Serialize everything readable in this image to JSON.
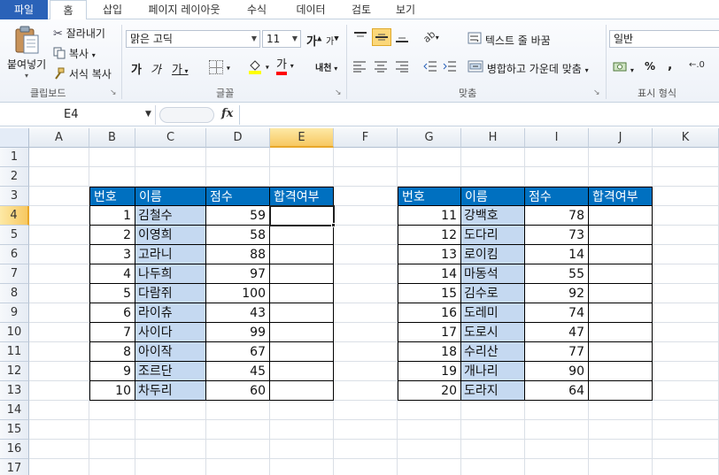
{
  "ribbon_tabs": {
    "file": "파일",
    "home": "홈",
    "insert": "삽입",
    "page_layout": "페이지 레이아웃",
    "formulas": "수식",
    "data": "데이터",
    "review": "검토",
    "view": "보기"
  },
  "clipboard": {
    "paste": "붙여넣기",
    "cut": "잘라내기",
    "copy": "복사",
    "format_painter": "서식 복사",
    "group_label": "클립보드"
  },
  "font": {
    "font_name": "맑은 고딕",
    "font_size": "11",
    "grow": "가",
    "shrink": "가",
    "bold": "가",
    "italic": "가",
    "underline": "가",
    "font_color_glyph": "가",
    "phonetic": "내천",
    "group_label": "글꼴",
    "fill_color": "#ffff00",
    "text_color": "#ff0000"
  },
  "alignment": {
    "wrap_text": "텍스트 줄 바꿈",
    "merge_center": "병합하고 가운데 맞춤",
    "group_label": "맞춤"
  },
  "number": {
    "format": "일반",
    "percent": "%",
    "comma": ",",
    "group_label": "표시 형식"
  },
  "formula_bar": {
    "name_box": "E4",
    "fx": "fx",
    "content": ""
  },
  "columns": [
    "A",
    "B",
    "C",
    "D",
    "E",
    "F",
    "G",
    "H",
    "I",
    "J",
    "K"
  ],
  "rows": [
    "1",
    "2",
    "3",
    "4",
    "5",
    "6",
    "7",
    "8",
    "9",
    "10",
    "11",
    "12",
    "13",
    "14",
    "15",
    "16",
    "17"
  ],
  "active_cell": "E4",
  "table1": {
    "headers": [
      "번호",
      "이름",
      "점수",
      "합격여부"
    ],
    "rows": [
      {
        "no": "1",
        "name": "김철수",
        "score": "59",
        "pass": ""
      },
      {
        "no": "2",
        "name": "이영희",
        "score": "58",
        "pass": ""
      },
      {
        "no": "3",
        "name": "고라니",
        "score": "88",
        "pass": ""
      },
      {
        "no": "4",
        "name": "나두희",
        "score": "97",
        "pass": ""
      },
      {
        "no": "5",
        "name": "다람쥐",
        "score": "100",
        "pass": ""
      },
      {
        "no": "6",
        "name": "라이츄",
        "score": "43",
        "pass": ""
      },
      {
        "no": "7",
        "name": "사이다",
        "score": "99",
        "pass": ""
      },
      {
        "no": "8",
        "name": "아이작",
        "score": "67",
        "pass": ""
      },
      {
        "no": "9",
        "name": "조르단",
        "score": "45",
        "pass": ""
      },
      {
        "no": "10",
        "name": "차두리",
        "score": "60",
        "pass": ""
      }
    ]
  },
  "table2": {
    "headers": [
      "번호",
      "이름",
      "점수",
      "합격여부"
    ],
    "rows": [
      {
        "no": "11",
        "name": "강백호",
        "score": "78",
        "pass": ""
      },
      {
        "no": "12",
        "name": "도다리",
        "score": "73",
        "pass": ""
      },
      {
        "no": "13",
        "name": "로이킴",
        "score": "14",
        "pass": ""
      },
      {
        "no": "14",
        "name": "마동석",
        "score": "55",
        "pass": ""
      },
      {
        "no": "15",
        "name": "김수로",
        "score": "92",
        "pass": ""
      },
      {
        "no": "16",
        "name": "도레미",
        "score": "74",
        "pass": ""
      },
      {
        "no": "17",
        "name": "도로시",
        "score": "47",
        "pass": ""
      },
      {
        "no": "18",
        "name": "수리산",
        "score": "77",
        "pass": ""
      },
      {
        "no": "19",
        "name": "개나리",
        "score": "90",
        "pass": ""
      },
      {
        "no": "20",
        "name": "도라지",
        "score": "64",
        "pass": ""
      }
    ]
  },
  "colors": {
    "header_fill": "#0070c0",
    "name_fill": "#c5d9f1",
    "file_tab": "#2a62b8",
    "selected_header": "#f7c861"
  }
}
